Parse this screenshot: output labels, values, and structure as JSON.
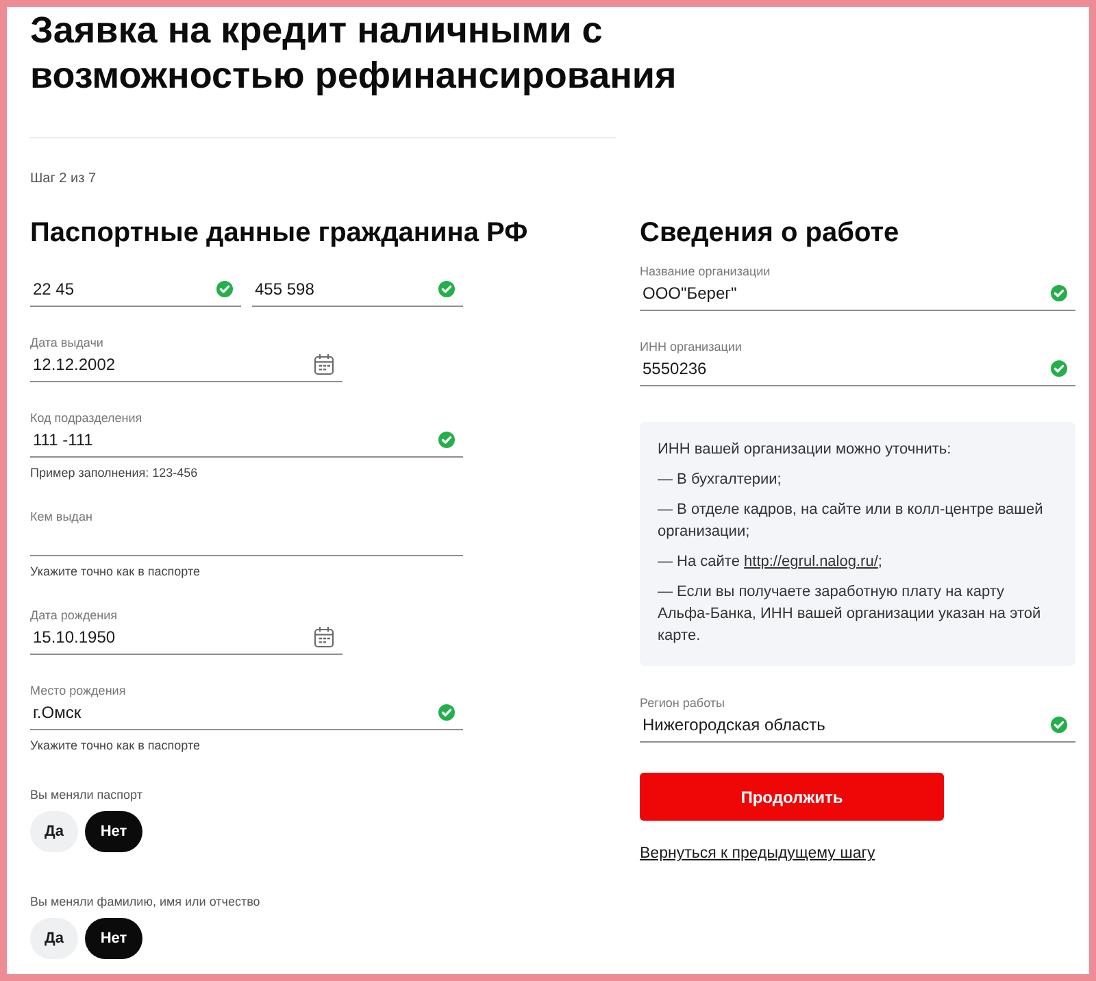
{
  "title": "Заявка на кредит наличными с возможностью рефинансирования",
  "step": "Шаг 2 из 7",
  "passport": {
    "heading": "Паспортные данные гражданина РФ",
    "series_number": [
      {
        "kind": "text",
        "value": "22 45",
        "valid": true
      },
      {
        "kind": "text",
        "value": "455 598",
        "valid": true
      }
    ],
    "fields": [
      {
        "kind": "date",
        "label": "Дата выдачи",
        "value": "12.12.2002",
        "valid": false
      },
      {
        "kind": "text",
        "label": "Код подразделения",
        "value": "111 -111",
        "valid": true,
        "helper": "Пример заполнения: 123-456"
      },
      {
        "kind": "text",
        "label": "Кем выдан",
        "valid": false,
        "helper": "Укажите точно как в паспорте"
      },
      {
        "kind": "date",
        "label": "Дата рождения",
        "value": "15.10.1950",
        "valid": false
      },
      {
        "kind": "text",
        "label": "Место рождения",
        "value": "г.Омск",
        "valid": true,
        "helper": "Укажите точно как в паспорте"
      }
    ],
    "questions": [
      {
        "label": "Вы меняли паспорт",
        "options": [
          {
            "label": "Да",
            "selected": false
          },
          {
            "label": "Нет",
            "selected": true
          }
        ]
      },
      {
        "label": "Вы меняли фамилию, имя или отчество",
        "options": [
          {
            "label": "Да",
            "selected": false
          },
          {
            "label": "Нет",
            "selected": true
          }
        ]
      }
    ]
  },
  "work": {
    "heading": "Сведения о работе",
    "fields": [
      {
        "kind": "text",
        "label": "Название организации",
        "value": "ООО\"Берег\"",
        "valid": true
      },
      {
        "kind": "text",
        "label": "ИНН организации",
        "value": "5550236",
        "valid": true
      }
    ],
    "info": {
      "intro": "ИНН вашей организации можно уточнить:",
      "items": [
        {
          "text": "— В бухгалтерии;"
        },
        {
          "text": "— В отделе кадров, на сайте или в колл-центре вашей организации;"
        },
        {
          "text": "— На сайте ",
          "link": "http://egrul.nalog.ru/",
          "after": ";"
        },
        {
          "text": "— Если вы получаете заработную плату на карту Альфа-Банка, ИНН вашей организации указан на этой карте."
        }
      ]
    },
    "region_field": {
      "kind": "text",
      "label": "Регион работы",
      "value": "Нижегородская область",
      "valid": true
    },
    "continue_button": "Продолжить",
    "back_link": "Вернуться к предыдущему шагу"
  }
}
